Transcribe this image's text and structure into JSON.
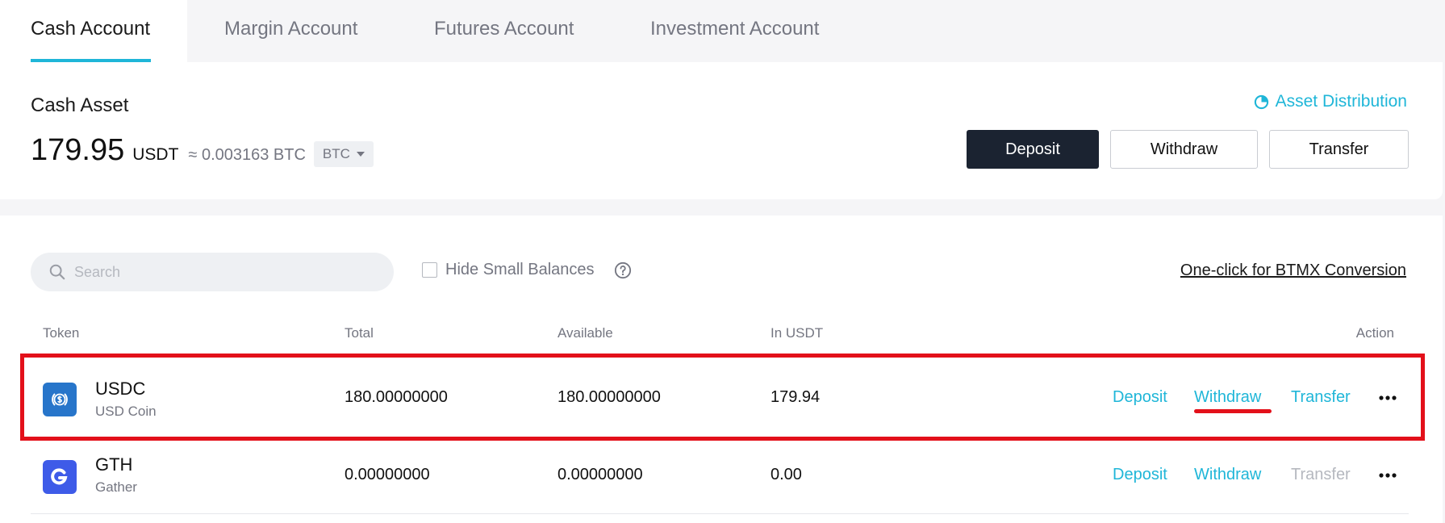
{
  "tabs": [
    {
      "label": "Cash Account",
      "active": true
    },
    {
      "label": "Margin Account",
      "active": false
    },
    {
      "label": "Futures Account",
      "active": false
    },
    {
      "label": "Investment Account",
      "active": false
    }
  ],
  "asset": {
    "title": "Cash Asset",
    "distribution_link": "Asset Distribution",
    "value": "179.95",
    "unit": "USDT",
    "approx": "≈ 0.003163 BTC",
    "coin_select": "BTC",
    "buttons": {
      "deposit": "Deposit",
      "withdraw": "Withdraw",
      "transfer": "Transfer"
    }
  },
  "filters": {
    "search_placeholder": "Search",
    "hide_small_label": "Hide Small Balances",
    "hide_small_checked": false,
    "conversion_link": "One-click for BTMX Conversion"
  },
  "table": {
    "headers": {
      "token": "Token",
      "total": "Total",
      "available": "Available",
      "in_usdt": "In USDT",
      "action": "Action"
    },
    "rows": [
      {
        "symbol": "USDC",
        "name": "USD Coin",
        "icon": "usdc-coin-icon",
        "icon_color": "#2775ca",
        "total": "180.00000000",
        "available": "180.00000000",
        "in_usdt": "179.94",
        "actions": {
          "deposit": "Deposit",
          "withdraw": "Withdraw",
          "transfer": "Transfer"
        },
        "transfer_enabled": true,
        "highlighted": true
      },
      {
        "symbol": "GTH",
        "name": "Gather",
        "icon": "gather-coin-icon",
        "icon_color": "#3e5be8",
        "total": "0.00000000",
        "available": "0.00000000",
        "in_usdt": "0.00",
        "actions": {
          "deposit": "Deposit",
          "withdraw": "Withdraw",
          "transfer": "Transfer"
        },
        "transfer_enabled": false,
        "highlighted": false
      }
    ]
  },
  "colors": {
    "accent": "#1fb6d8",
    "highlight": "#e3101a",
    "primary_button": "#1b2331"
  }
}
